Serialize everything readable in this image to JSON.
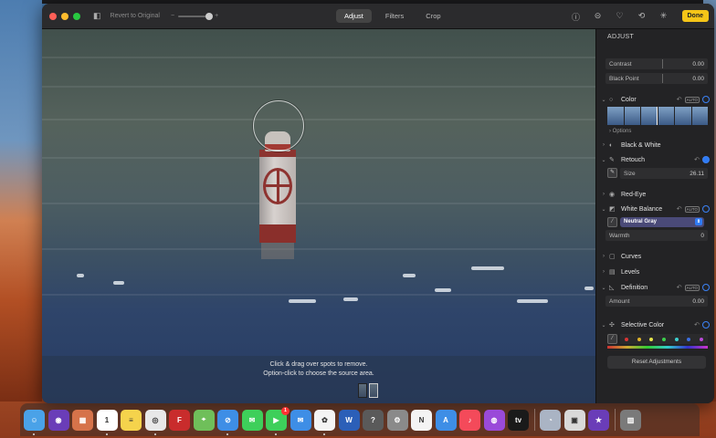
{
  "window": {
    "revert_label": "Revert to Original",
    "zoom_minus": "−",
    "zoom_plus": "+",
    "zoom_level": 0.85,
    "tabs": [
      {
        "label": "Adjust",
        "active": true
      },
      {
        "label": "Filters",
        "active": false
      },
      {
        "label": "Crop",
        "active": false
      }
    ],
    "title_icons": [
      "info-icon",
      "more-icon",
      "heart-icon",
      "rotate-icon",
      "magic-wand-icon"
    ],
    "done_label": "Done"
  },
  "photo": {
    "hint_line1": "Click & drag over spots to remove.",
    "hint_line2": "Option-click to choose the source area."
  },
  "sidebar": {
    "header": "ADJUST",
    "contrast": {
      "label": "Contrast",
      "value": "0.00"
    },
    "black_point": {
      "label": "Black Point",
      "value": "0.00"
    },
    "color": {
      "label": "Color",
      "auto": "AUTO",
      "options": "Options"
    },
    "black_white": {
      "label": "Black & White"
    },
    "retouch": {
      "label": "Retouch",
      "size_label": "Size",
      "size_value": "26.11"
    },
    "red_eye": {
      "label": "Red-Eye"
    },
    "white_balance": {
      "label": "White Balance",
      "auto": "AUTO",
      "dropdown": "Neutral Gray",
      "warmth_label": "Warmth",
      "warmth_value": "0"
    },
    "curves": {
      "label": "Curves"
    },
    "levels": {
      "label": "Levels"
    },
    "definition": {
      "label": "Definition",
      "auto": "AUTO",
      "amount_label": "Amount",
      "amount_value": "0.00"
    },
    "selective_color": {
      "label": "Selective Color",
      "swatches": [
        "#d93434",
        "#e0b42a",
        "#e6e64a",
        "#3ccf4d",
        "#3ccfcf",
        "#3b6ee0",
        "#b94ad9"
      ]
    },
    "reset_label": "Reset Adjustments"
  },
  "dock": {
    "items": [
      {
        "name": "finder",
        "color": "#4aa2e8",
        "glyph": "☺",
        "running": true
      },
      {
        "name": "siri",
        "color": "#6a3db8",
        "glyph": "◉",
        "running": false
      },
      {
        "name": "launchpad",
        "color": "#d6734a",
        "glyph": "▦",
        "running": false
      },
      {
        "name": "calendar",
        "color": "#ffffff",
        "glyph": "1",
        "running": true
      },
      {
        "name": "notes",
        "color": "#f5d34c",
        "glyph": "≡",
        "running": false
      },
      {
        "name": "chrome",
        "color": "#e8e8e8",
        "glyph": "◎",
        "running": true
      },
      {
        "name": "flashcard",
        "color": "#c92c2c",
        "glyph": "F",
        "running": false
      },
      {
        "name": "maps",
        "color": "#6fbf5a",
        "glyph": "⌖",
        "running": false
      },
      {
        "name": "safari",
        "color": "#3e8ee6",
        "glyph": "⊘",
        "running": true
      },
      {
        "name": "messages",
        "color": "#3ecf5a",
        "glyph": "✉",
        "running": false
      },
      {
        "name": "facetime",
        "color": "#3ecf5a",
        "glyph": "▶",
        "running": true,
        "badge": "1"
      },
      {
        "name": "mail",
        "color": "#3e8ee6",
        "glyph": "✉",
        "running": false
      },
      {
        "name": "photos",
        "color": "#f4f4f4",
        "glyph": "✿",
        "running": true
      },
      {
        "name": "word",
        "color": "#2b5fb8",
        "glyph": "W",
        "running": false
      },
      {
        "name": "help",
        "color": "#5a5a5a",
        "glyph": "?",
        "running": false
      },
      {
        "name": "system-preferences",
        "color": "#8a8a8a",
        "glyph": "⚙",
        "running": false
      },
      {
        "name": "news",
        "color": "#f4f4f4",
        "glyph": "N",
        "running": false
      },
      {
        "name": "app-store",
        "color": "#3e8ee6",
        "glyph": "A",
        "running": false
      },
      {
        "name": "music",
        "color": "#f44a5a",
        "glyph": "♪",
        "running": false
      },
      {
        "name": "podcasts",
        "color": "#9a4ad9",
        "glyph": "◍",
        "running": false
      },
      {
        "name": "tv",
        "color": "#1a1a1a",
        "glyph": "tv",
        "running": false
      },
      {
        "name": "preview",
        "color": "#aab4c4",
        "glyph": "◔",
        "running": false
      },
      {
        "name": "photo-booth",
        "color": "#d9d9d9",
        "glyph": "▣",
        "running": false
      },
      {
        "name": "imovie",
        "color": "#6a3db8",
        "glyph": "★",
        "running": false
      },
      {
        "name": "trash",
        "color": "#7a7a7a",
        "glyph": "▥",
        "running": false
      }
    ]
  }
}
